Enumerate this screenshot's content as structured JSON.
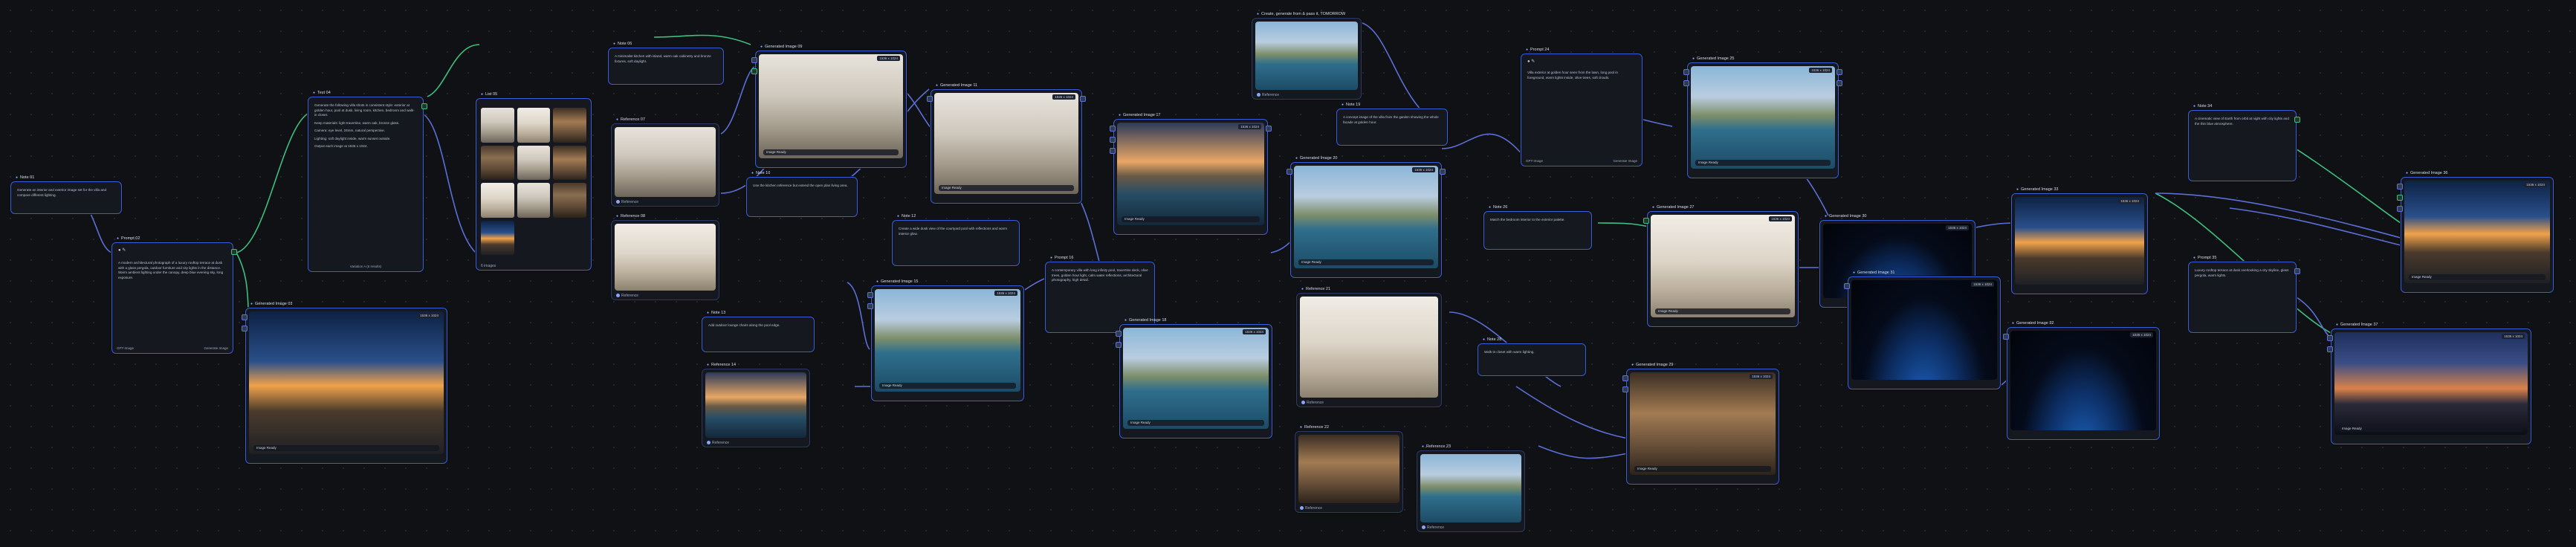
{
  "canvas": {
    "background": "#0f1115",
    "accent": "#3a5fd9",
    "wire_blue": "#5b6fd6",
    "wire_green": "#3fbf7f"
  },
  "nodes": {
    "note_left": {
      "title": "Note 01",
      "text": "Generate an interior and exterior image set for the villa and compare different lighting."
    },
    "prompt_left": {
      "title": "Prompt 02",
      "text": "A modern architectural photograph of a luxury rooftop terrace at dusk with a glass pergola, outdoor furniture and city lights in the distance. Warm ambient lighting under the canopy, deep blue evening sky, long exposure.",
      "footer_left": "GPT-Image",
      "footer_right": "Generate Image"
    },
    "gen_terrace": {
      "title": "Generated Image 03",
      "badge": "1536 x 1024",
      "bar": "Image Ready"
    },
    "text_list": {
      "title": "Text 04",
      "paragraphs": [
        "Generate the following villa shots in consistent style: exterior at golden hour, pool at dusk, living room, kitchen, bedroom and walk-in closet.",
        "Keep materials: light travertine, warm oak, bronze glass.",
        "Camera: eye level, 24mm, natural perspective.",
        "Lighting: soft daylight inside, warm sunset outside.",
        "Output each image at 1536 x 1024."
      ],
      "footer": "Variation A (6 results)"
    },
    "grid_gallery": {
      "title": "List 05",
      "footer": "6 images"
    },
    "note_top": {
      "title": "Note 06",
      "text": "A minimalist kitchen with island, warm oak cabinetry and bronze fixtures, soft daylight."
    },
    "ref_kitchen": {
      "title": "Reference 07",
      "footer": "Reference"
    },
    "ref_living": {
      "title": "Reference 08",
      "footer": "Reference"
    },
    "gen_living1": {
      "title": "Generated Image 09",
      "badge": "1536 x 1024",
      "bar": "Image Ready"
    },
    "note_mid": {
      "title": "Note 10",
      "text": "Use the kitchen reference but extend the open plan living area."
    },
    "gen_living2": {
      "title": "Generated Image 11",
      "badge": "1536 x 1024",
      "bar": "Image Ready"
    },
    "note_desc": {
      "title": "Note 12",
      "text": "Create a wide dusk view of the courtyard pool with reflections and warm interior glow."
    },
    "note_small": {
      "title": "Note 13",
      "text": "Add outdoor lounge chairs along the pool edge."
    },
    "ref_dusk": {
      "title": "Reference 14",
      "footer": "Reference"
    },
    "gen_pool1": {
      "title": "Generated Image 15",
      "badge": "1536 x 1024",
      "bar": "Image Ready"
    },
    "prompt_mid": {
      "title": "Prompt 16",
      "text": "A contemporary villa with long infinity pool, travertine deck, olive trees, golden hour light, calm water reflections, architectural photography, high detail.",
      "footer": "Generate Image"
    },
    "gen_dusk_view": {
      "title": "Generated Image 17",
      "badge": "1536 x 1024",
      "bar": "Image Ready"
    },
    "gen_pool2": {
      "title": "Generated Image 18",
      "badge": "1536 x 1024",
      "bar": "Image Ready"
    },
    "top_single": {
      "title": "Create, generate from & pass it, TOMORROW",
      "footer": "Reference"
    },
    "note_upper": {
      "title": "Note 19",
      "text": "A concept image of the villa from the garden showing the whole facade at golden hour."
    },
    "gen_facade": {
      "title": "Generated Image 20",
      "badge": "1536 x 1024",
      "bar": "Image Ready"
    },
    "ref_bedroom": {
      "title": "Reference 21",
      "footer": "Reference"
    },
    "ref_closet": {
      "title": "Reference 22",
      "footer": "Reference"
    },
    "ref_closet2": {
      "title": "Reference 23",
      "footer": "Reference"
    },
    "prompt_right": {
      "title": "Prompt 24",
      "text": "Villa exterior at golden hour seen from the lawn, long pool in foreground, warm lights inside, olive trees, soft clouds.",
      "footer_left": "GPT-Image",
      "footer_right": "Generate Image"
    },
    "gen_exterior": {
      "title": "Generated Image 25",
      "badge": "1536 x 1024",
      "bar": "Image Ready"
    },
    "note_right1": {
      "title": "Note 26",
      "text": "Match the bedroom interior to the exterior palette."
    },
    "gen_bedroom": {
      "title": "Generated Image 27",
      "badge": "1536 x 1024",
      "bar": "Image Ready"
    },
    "note_right2": {
      "title": "Note 28",
      "text": "Walk-in closet with warm lighting."
    },
    "gen_closet": {
      "title": "Generated Image 29",
      "badge": "1536 x 1024",
      "bar": "Image Ready"
    },
    "gen_earth1": {
      "title": "Generated Image 30",
      "badge": "1536 x 1024"
    },
    "gen_earth2": {
      "title": "Generated Image 31",
      "badge": "1536 x 1024"
    },
    "gen_earth3": {
      "title": "Generated Image 32",
      "badge": "1536 x 1024"
    },
    "gen_terrace2": {
      "title": "Generated Image 33",
      "badge": "1536 x 1024"
    },
    "note_far": {
      "title": "Note 34",
      "text": "A cinematic view of Earth from orbit at night with city lights and the thin blue atmosphere."
    },
    "prompt_far": {
      "title": "Prompt 35",
      "text": "Luxury rooftop terrace at dusk overlooking a city skyline, glass pergola, warm lights."
    },
    "gen_final1": {
      "title": "Generated Image 36",
      "badge": "1536 x 1024",
      "bar": "Image Ready"
    },
    "gen_final2": {
      "title": "Generated Image 37",
      "badge": "1536 x 1024",
      "bar": "Image Ready"
    }
  }
}
